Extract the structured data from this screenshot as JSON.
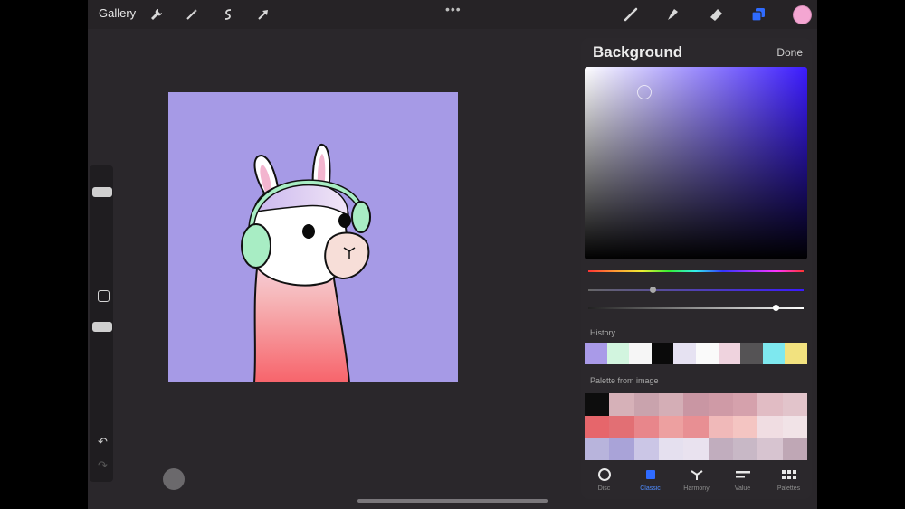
{
  "topbar": {
    "gallery_label": "Gallery",
    "more_label": "•••",
    "left_tools": [
      "wrench-icon",
      "magic-wand-icon",
      "selection-icon",
      "move-icon"
    ],
    "right_tools": [
      "brush-icon",
      "smudge-icon",
      "eraser-icon",
      "layers-icon"
    ],
    "current_color": "#f4a6d2"
  },
  "canvas": {
    "background_color": "#a69ae6"
  },
  "sidebar": {
    "undo_label": "↶",
    "redo_label": "↷"
  },
  "panel": {
    "title": "Background",
    "done_label": "Done",
    "history_label": "History",
    "palette_label": "Palette from image",
    "history_colors": [
      "#a99ae8",
      "#d2f5df",
      "#f6f6f6",
      "#0a0a0a",
      "#e6e2f2",
      "#fafafa",
      "#efd3de",
      "#555355",
      "#7ee8ef",
      "#f2e27f"
    ],
    "palette_colors": [
      "#0d0d0d",
      "#d6b1b8",
      "#c9a3ad",
      "#d4aeb6",
      "#c996a3",
      "#cf9aa6",
      "#d5a1ac",
      "#e1bcc4",
      "#e2c4cb",
      "#e6666b",
      "#e26f74",
      "#e8868b",
      "#eda0a0",
      "#e88f93",
      "#f0b9b9",
      "#f4c5c2",
      "#f0dde2",
      "#f1e3e7",
      "#b8b4dc",
      "#a9a3d8",
      "#cbc6e6",
      "#e5e0ef",
      "#e9e2ef",
      "#c1adbe",
      "#c8b8c6",
      "#d7c4d0",
      "#bfa7b5"
    ],
    "tabs": [
      {
        "icon": "disc-icon",
        "label": "Disc"
      },
      {
        "icon": "classic-icon",
        "label": "Classic"
      },
      {
        "icon": "harmony-icon",
        "label": "Harmony"
      },
      {
        "icon": "value-icon",
        "label": "Value"
      },
      {
        "icon": "palettes-icon",
        "label": "Palettes"
      }
    ],
    "active_tab": "Classic"
  }
}
